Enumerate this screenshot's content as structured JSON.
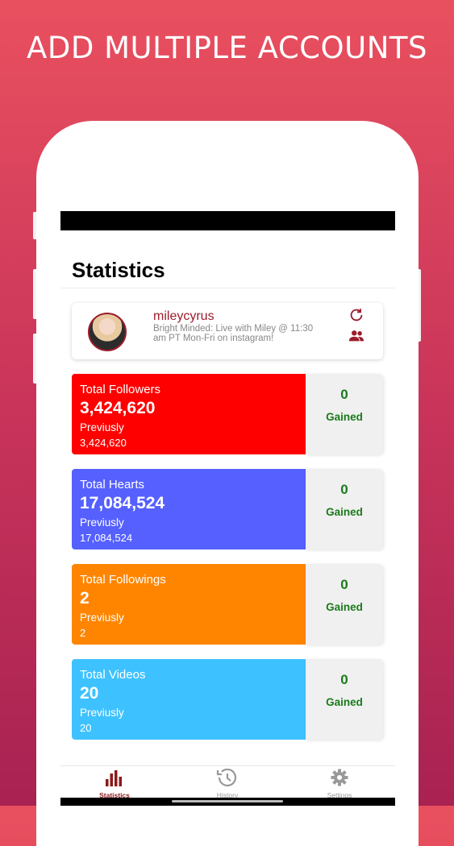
{
  "promo": {
    "headline": "ADD MULTIPLE ACCOUNTS"
  },
  "header": {
    "title": "Statistics"
  },
  "profile": {
    "username": "mileycyrus",
    "bio": "Bright Minded: Live with Miley @ 11:30 am PT Mon-Fri on instagram!",
    "refresh_icon": "refresh-icon",
    "accounts_icon": "users-icon"
  },
  "stats": [
    {
      "label": "Total Followers",
      "value": "3,424,620",
      "previously_label": "Previusly",
      "previous": "3,424,620",
      "gained": "0",
      "gained_label": "Gained",
      "color": "#ff0000"
    },
    {
      "label": "Total Hearts",
      "value": "17,084,524",
      "previously_label": "Previusly",
      "previous": "17,084,524",
      "gained": "0",
      "gained_label": "Gained",
      "color": "#5560ff"
    },
    {
      "label": "Total Followings",
      "value": "2",
      "previously_label": "Previusly",
      "previous": "2",
      "gained": "0",
      "gained_label": "Gained",
      "color": "#ff8500"
    },
    {
      "label": "Total Videos",
      "value": "20",
      "previously_label": "Previusly",
      "previous": "20",
      "gained": "0",
      "gained_label": "Gained",
      "color": "#3ec2ff"
    }
  ],
  "tabs": [
    {
      "label": "Statistics",
      "icon": "bar-chart-icon",
      "active": true
    },
    {
      "label": "History",
      "icon": "history-icon",
      "active": false
    },
    {
      "label": "Settings",
      "icon": "gear-icon",
      "active": false
    }
  ],
  "colors": {
    "accent": "#9b1c2c",
    "gained": "#1a7a1a"
  }
}
